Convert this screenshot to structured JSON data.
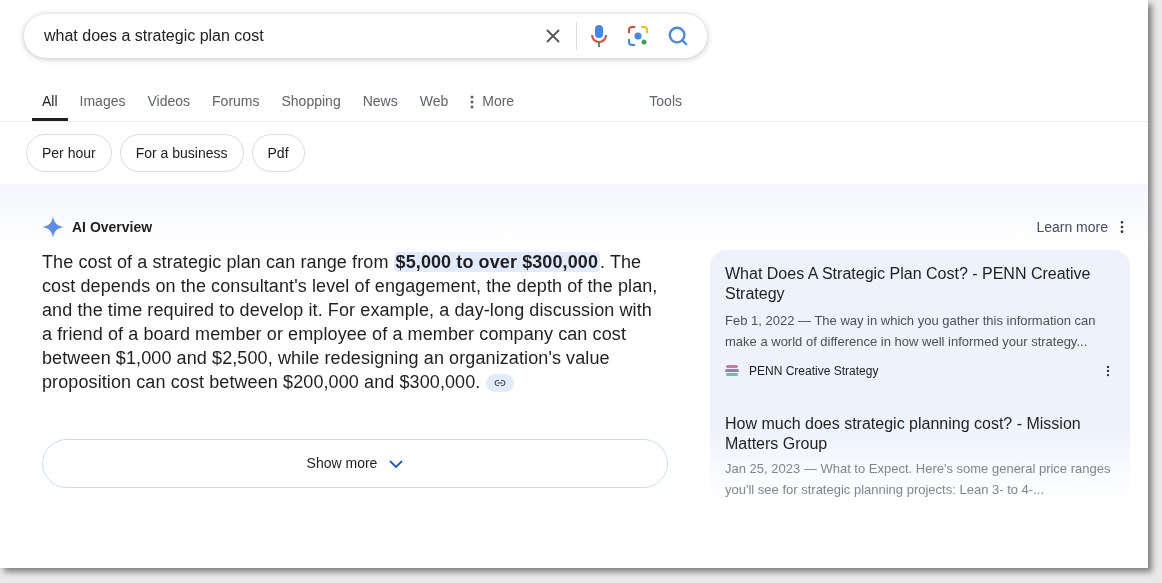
{
  "search": {
    "value": "what does a strategic plan cost"
  },
  "tabs": [
    {
      "label": "All",
      "selected": true
    },
    {
      "label": "Images",
      "selected": false
    },
    {
      "label": "Videos",
      "selected": false
    },
    {
      "label": "Forums",
      "selected": false
    },
    {
      "label": "Shopping",
      "selected": false
    },
    {
      "label": "News",
      "selected": false
    },
    {
      "label": "Web",
      "selected": false
    }
  ],
  "more_tab": {
    "label": "More"
  },
  "tools": {
    "label": "Tools"
  },
  "chips": [
    "Per hour",
    "For a business",
    "Pdf"
  ],
  "ai_overview": {
    "title": "AI Overview",
    "learn_more": "Learn more",
    "text": "The cost of a strategic plan can range from **$5,000 to over $300,000**. The cost depends on the consultant's level of engagement, the depth of the plan, and the time required to develop it. For example, a day-long discussion with a friend of a board member or employee of a member company can cost between $1,000 and $2,500, while redesigning an organization's value proposition can cost between $200,000 and $300,000.",
    "show_more": "Show more"
  },
  "sources": [
    {
      "title": "What Does A Strategic Plan Cost? - PENN Creative Strategy",
      "snippet": "Feb 1, 2022 — The way in which you gather this information can make a world of difference in how well informed your strategy...",
      "site": "PENN Creative Strategy"
    },
    {
      "title": "How much does strategic planning cost? - Mission Matters Group",
      "snippet": "Jan 25, 2023 — What to Expect. Here's some general price ranges you'll see for strategic planning projects: Lean 3- to 4-..."
    }
  ]
}
